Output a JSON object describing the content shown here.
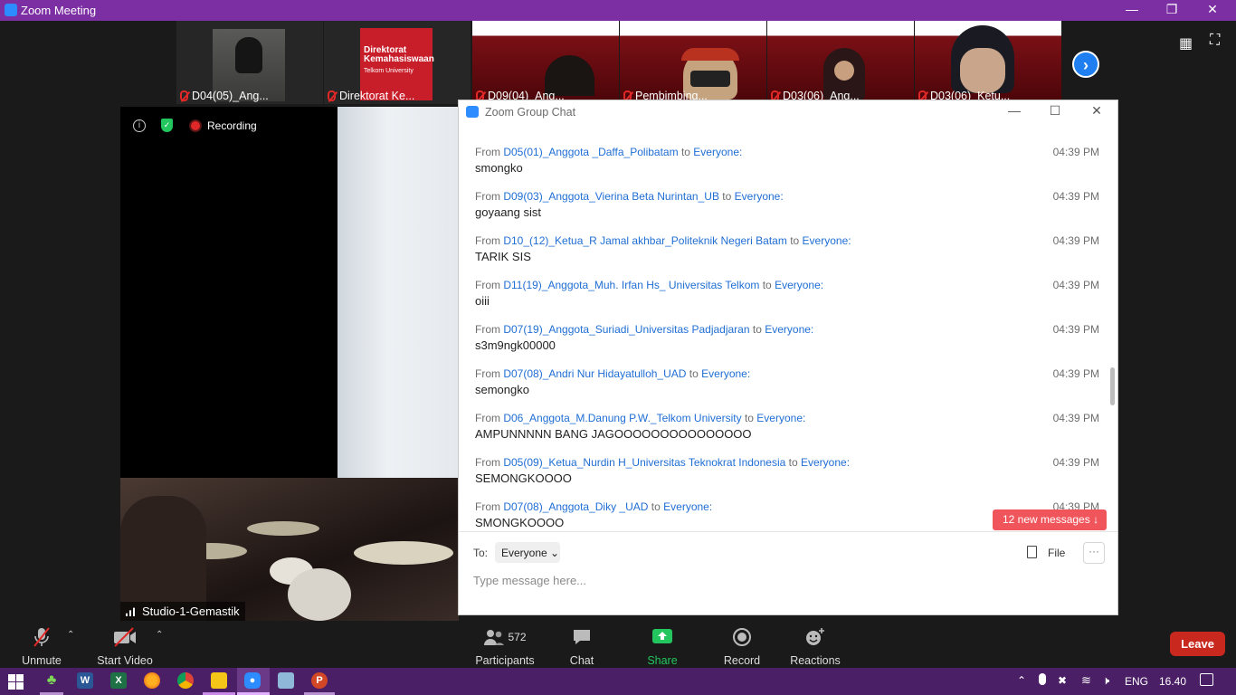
{
  "window": {
    "title": "Zoom Meeting"
  },
  "tiles": [
    {
      "name": "D04(05)_Ang..."
    },
    {
      "name": "Direktorat Ke...",
      "logo_text": "Direktorat Kemahasiswaan",
      "logo_sub": "Telkom University"
    },
    {
      "name": "D09(04)_Ang..."
    },
    {
      "name": "Pembimbing..."
    },
    {
      "name": "D03(06)_Ang..."
    },
    {
      "name": "D03(06)_Ketu..."
    }
  ],
  "main_video": {
    "recording_label": "Recording",
    "participant_label": "Studio-1-Gemastik"
  },
  "chat": {
    "title": "Zoom Group Chat",
    "messages": [
      {
        "prefix": "From",
        "sender": "D05(01)_Anggota _Daffa_Polibatam",
        "to_word": "to",
        "recipient": "Everyone:",
        "time": "04:39 PM",
        "text": "smongko"
      },
      {
        "prefix": "From",
        "sender": "D09(03)_Anggota_Vierina Beta Nurintan_UB",
        "to_word": "to",
        "recipient": "Everyone:",
        "time": "04:39 PM",
        "text": "goyaang sist"
      },
      {
        "prefix": "From",
        "sender": "D10_(12)_Ketua_R Jamal akhbar_Politeknik Negeri Batam",
        "to_word": "to",
        "recipient": "Everyone:",
        "time": "04:39 PM",
        "text": "TARIK SIS"
      },
      {
        "prefix": "From",
        "sender": "D11(19)_Anggota_Muh. Irfan Hs_ Universitas Telkom",
        "to_word": "to",
        "recipient": "Everyone:",
        "time": "04:39 PM",
        "text": "oiii"
      },
      {
        "prefix": "From",
        "sender": "D07(19)_Anggota_Suriadi_Universitas Padjadjaran",
        "to_word": "to",
        "recipient": "Everyone:",
        "time": "04:39 PM",
        "text": "s3m9ngk00000"
      },
      {
        "prefix": "From",
        "sender": "D07(08)_Andri Nur Hidayatulloh_UAD",
        "to_word": "to",
        "recipient": "Everyone:",
        "time": "04:39 PM",
        "text": "semongko"
      },
      {
        "prefix": "From",
        "sender": "D06_Anggota_M.Danung P.W._Telkom University",
        "to_word": "to",
        "recipient": "Everyone:",
        "time": "04:39 PM",
        "text": "AMPUNNNNN BANG JAGOOOOOOOOOOOOOOO"
      },
      {
        "prefix": "From",
        "sender": "D05(09)_Ketua_Nurdin H_Universitas Teknokrat Indonesia",
        "to_word": "to",
        "recipient": "Everyone:",
        "time": "04:39 PM",
        "text": "SEMONGKOOOO"
      },
      {
        "prefix": "From",
        "sender": "D07(08)_Anggota_Diky _UAD",
        "to_word": "to",
        "recipient": "Everyone:",
        "time": "04:39 PM",
        "text": "SMONGKOOOO"
      }
    ],
    "new_messages": "12 new messages",
    "to_label": "To:",
    "to_value": "Everyone",
    "file_label": "File",
    "input_placeholder": "Type message here..."
  },
  "toolbar": {
    "unmute": "Unmute",
    "start_video": "Start Video",
    "participants_count": "572",
    "participants": "Participants",
    "chat": "Chat",
    "share_screen": "Share Screen",
    "record": "Record",
    "reactions": "Reactions",
    "leave": "Leave"
  },
  "taskbar": {
    "language": "ENG",
    "time": "16.40"
  },
  "colors": {
    "title_bar": "#7c2ea3",
    "share_green": "#22c55e",
    "leave_red": "#c8281e",
    "link_blue": "#1f6ed4",
    "new_msgs": "#f0555b",
    "taskbar": "#4b1f66"
  }
}
